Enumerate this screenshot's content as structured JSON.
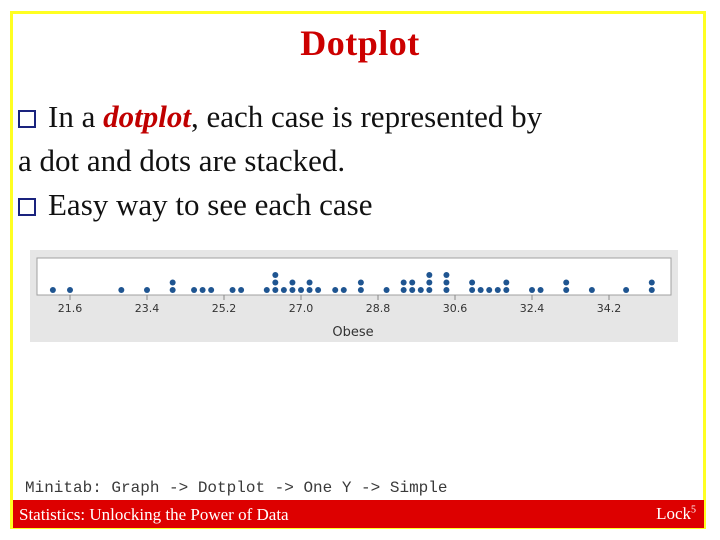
{
  "slide": {
    "title": "Dotplot",
    "bullets": [
      {
        "icon": "square-bullet-icon",
        "pre": "In a ",
        "emph": "dotplot",
        "post": ", each case is represented by",
        "cont": "a dot and dots are stacked."
      },
      {
        "icon": "square-bullet-icon",
        "text": "Easy way to see each case"
      }
    ],
    "minitab_note": "Minitab: Graph -> Dotplot -> One Y -> Simple",
    "footer_left": "Statistics: Unlocking the Power of Data",
    "footer_right_base": "Lock",
    "footer_right_sup": "5"
  },
  "colors": {
    "title": "#cc0000",
    "frame": "#ffff22",
    "footer_bg": "#dd0000",
    "dot": "#1f5591",
    "plot_bg": "#e6e6e6"
  },
  "chart_data": {
    "type": "scatter",
    "subtype": "dotplot",
    "title": "",
    "xlabel": "Obese",
    "ylabel": "",
    "xlim": [
      20.9,
      35.5
    ],
    "xticks": [
      21.6,
      23.4,
      25.2,
      27.0,
      28.8,
      30.6,
      32.4,
      34.2
    ],
    "xtick_labels": [
      "21.6",
      "23.4",
      "25.2",
      "27.0",
      "28.8",
      "30.6",
      "32.4",
      "34.2"
    ],
    "grid": false,
    "legend": "none",
    "stacks": [
      {
        "x": 21.2,
        "count": 1
      },
      {
        "x": 21.6,
        "count": 1
      },
      {
        "x": 22.8,
        "count": 1
      },
      {
        "x": 23.4,
        "count": 1
      },
      {
        "x": 24.0,
        "count": 2
      },
      {
        "x": 24.5,
        "count": 1
      },
      {
        "x": 24.7,
        "count": 1
      },
      {
        "x": 24.9,
        "count": 1
      },
      {
        "x": 25.4,
        "count": 1
      },
      {
        "x": 25.6,
        "count": 1
      },
      {
        "x": 26.2,
        "count": 1
      },
      {
        "x": 26.4,
        "count": 3
      },
      {
        "x": 26.6,
        "count": 1
      },
      {
        "x": 26.8,
        "count": 2
      },
      {
        "x": 27.0,
        "count": 1
      },
      {
        "x": 27.2,
        "count": 2
      },
      {
        "x": 27.4,
        "count": 1
      },
      {
        "x": 27.8,
        "count": 1
      },
      {
        "x": 28.0,
        "count": 1
      },
      {
        "x": 28.4,
        "count": 2
      },
      {
        "x": 29.0,
        "count": 1
      },
      {
        "x": 29.4,
        "count": 2
      },
      {
        "x": 29.6,
        "count": 2
      },
      {
        "x": 29.8,
        "count": 1
      },
      {
        "x": 30.0,
        "count": 3
      },
      {
        "x": 30.4,
        "count": 3
      },
      {
        "x": 31.0,
        "count": 2
      },
      {
        "x": 31.2,
        "count": 1
      },
      {
        "x": 31.4,
        "count": 1
      },
      {
        "x": 31.6,
        "count": 1
      },
      {
        "x": 31.8,
        "count": 2
      },
      {
        "x": 32.4,
        "count": 1
      },
      {
        "x": 32.6,
        "count": 1
      },
      {
        "x": 33.2,
        "count": 2
      },
      {
        "x": 33.8,
        "count": 1
      },
      {
        "x": 34.6,
        "count": 1
      },
      {
        "x": 35.2,
        "count": 2
      }
    ]
  }
}
